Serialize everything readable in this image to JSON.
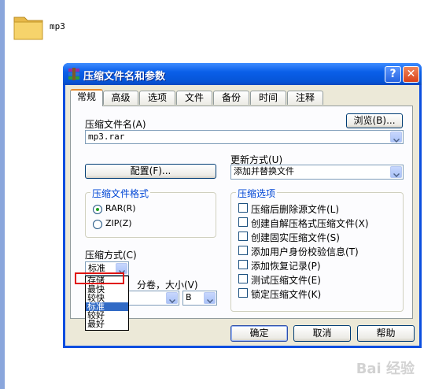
{
  "desktop": {
    "folder_label": "mp3"
  },
  "dialog": {
    "title": "压缩文件名和参数",
    "help_label": "?",
    "close_label": "✕",
    "tabs": [
      "常规",
      "高级",
      "选项",
      "文件",
      "备份",
      "时间",
      "注释"
    ],
    "archive_name_label": "压缩文件名(A)",
    "browse_label": "浏览(B)...",
    "archive_name_value": "mp3.rar",
    "update_mode_label": "更新方式(U)",
    "update_mode_value": "添加并替换文件",
    "profiles_label": "配置(F)...",
    "format_group": {
      "title": "压缩文件格式",
      "options": [
        "RAR(R)",
        "ZIP(Z)"
      ],
      "selected": "RAR(R)"
    },
    "method_label": "压缩方式(C)",
    "method_value": "标准",
    "method_options": [
      "存储",
      "最快",
      "较快",
      "标准",
      "较好",
      "最好"
    ],
    "method_selected": "标准",
    "split_label": "分卷，大小(V)",
    "split_unit": "B",
    "options_group": {
      "title": "压缩选项",
      "items": [
        "压缩后删除源文件(L)",
        "创建自解压格式压缩文件(X)",
        "创建固实压缩文件(S)",
        "添加用户身份校验信息(T)",
        "添加恢复记录(P)",
        "测试压缩文件(E)",
        "锁定压缩文件(K)"
      ]
    },
    "ok_label": "确定",
    "cancel_label": "取消",
    "help_button_label": "帮助"
  },
  "colors": {
    "title_bar": "#0a5fe9",
    "highlight_box": "#e0140f",
    "selection": "#316ac5"
  },
  "watermark": "Bai 经验"
}
